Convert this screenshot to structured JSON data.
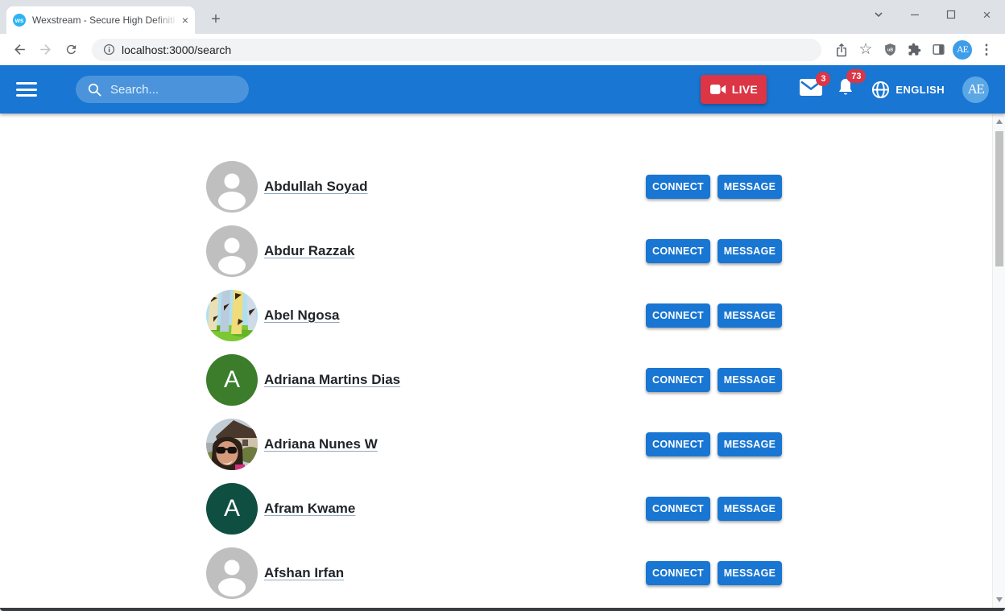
{
  "browser": {
    "tab": {
      "favicon_text": "ws",
      "title": "Wexstream - Secure High Definiti"
    },
    "url": "localhost:3000/search",
    "profile_initials": "AE"
  },
  "icons": {
    "plus": "+",
    "close": "×",
    "star": "☆",
    "menu_dots": "⋮"
  },
  "header": {
    "search_placeholder": "Search...",
    "live_label": "LIVE",
    "mail_badge": "3",
    "notification_badge": "73",
    "language_label": "ENGLISH",
    "avatar_initials": "AE"
  },
  "actions": {
    "connect_label": "CONNECT",
    "message_label": "MESSAGE"
  },
  "users": [
    {
      "name": "Abdullah Soyad",
      "avatar": {
        "type": "silhouette"
      }
    },
    {
      "name": "Abdur Razzak",
      "avatar": {
        "type": "silhouette"
      }
    },
    {
      "name": "Abel Ngosa",
      "avatar": {
        "type": "photo-trees"
      }
    },
    {
      "name": "Adriana Martins Dias",
      "avatar": {
        "type": "initial",
        "initial": "A",
        "color": "#3b7d2b"
      }
    },
    {
      "name": "Adriana Nunes W",
      "avatar": {
        "type": "photo-portrait"
      }
    },
    {
      "name": "Afram Kwame",
      "avatar": {
        "type": "initial",
        "initial": "A",
        "color": "#0f4f41"
      }
    },
    {
      "name": "Afshan Irfan",
      "avatar": {
        "type": "silhouette"
      }
    }
  ],
  "colors": {
    "header_blue": "#1976d2",
    "button_blue": "#1976d2",
    "live_red": "#dc3545",
    "badge_red": "#dc3545",
    "favicon_blue": "#2bb4f4",
    "profile_avatar_blue": "#3d9de9",
    "header_avatar_blue": "#5ba7e5",
    "default_avatar_gray": "#bfbfbf"
  }
}
